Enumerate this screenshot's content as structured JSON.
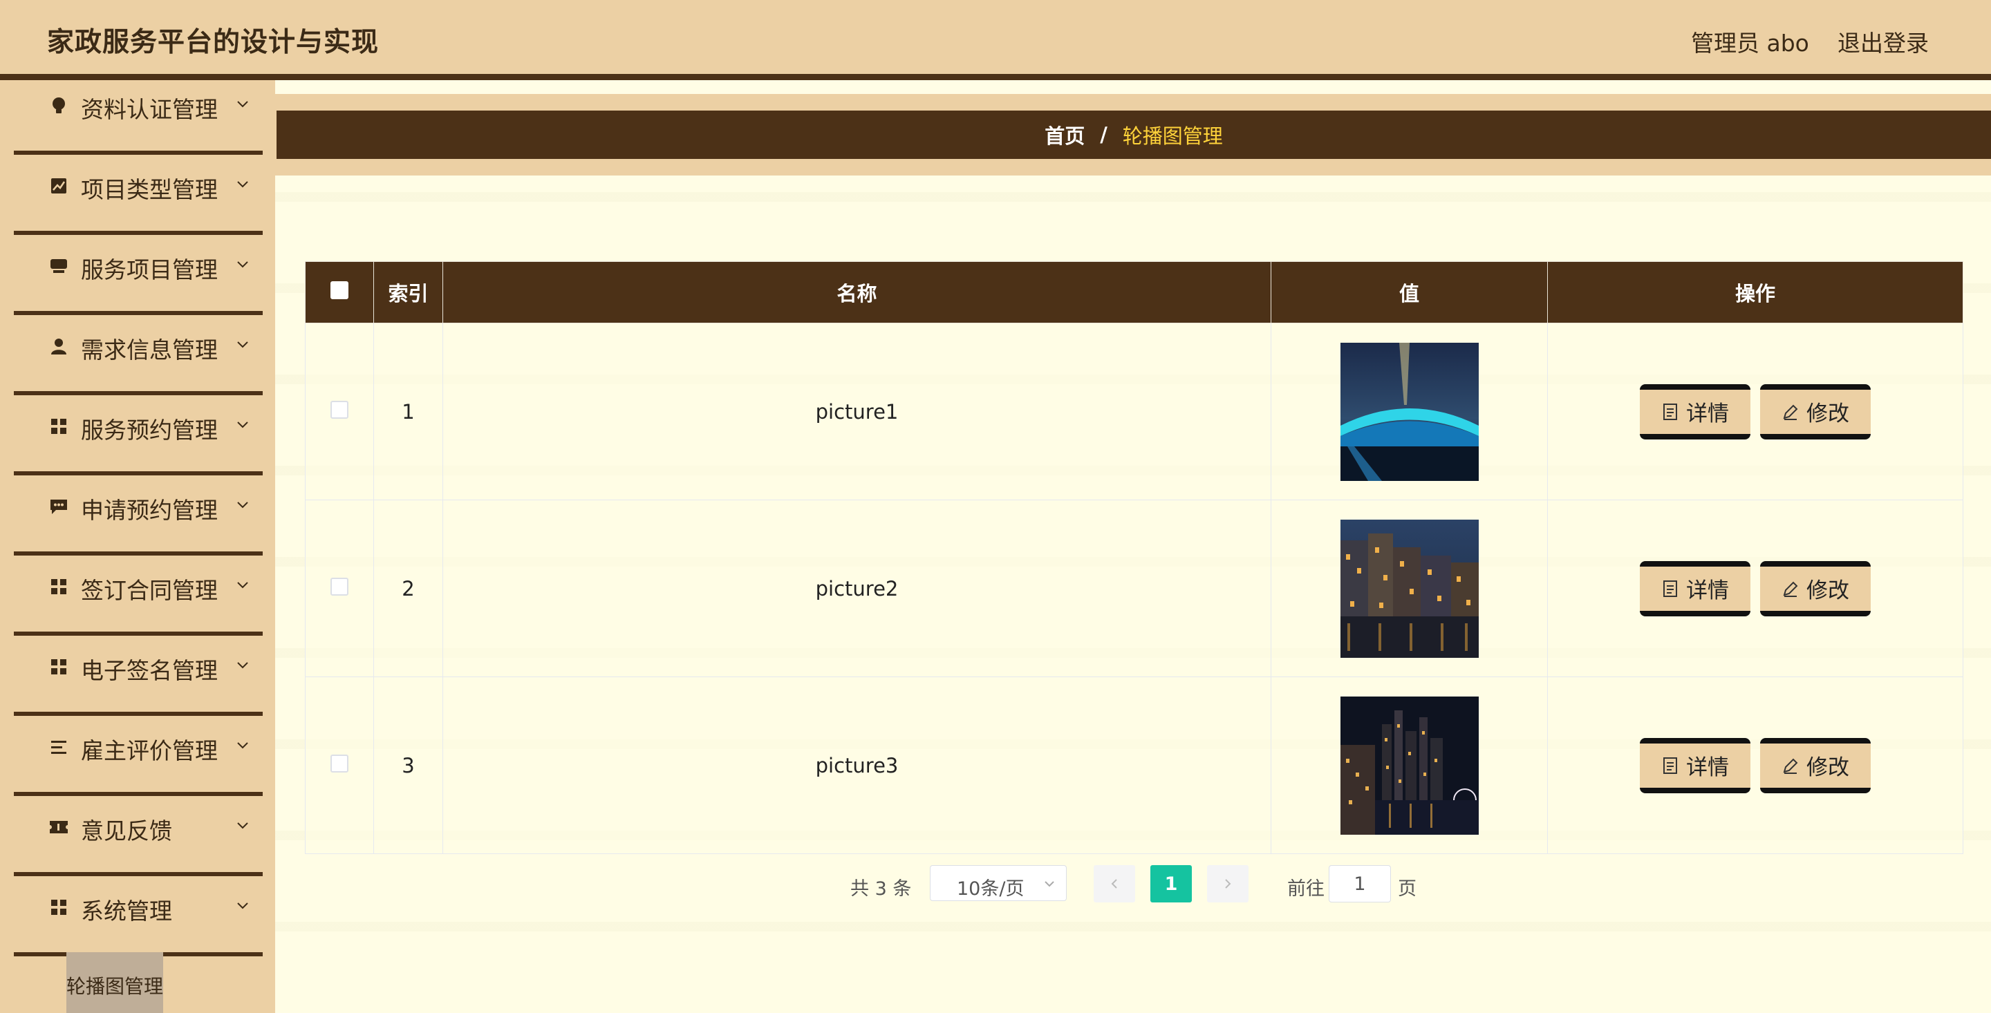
{
  "header": {
    "title": "家政服务平台的设计与实现",
    "user": "管理员 abo",
    "logout": "退出登录"
  },
  "sidebar": {
    "items": [
      {
        "label": "资料认证管理",
        "icon": "bulb-icon"
      },
      {
        "label": "项目类型管理",
        "icon": "chart-icon"
      },
      {
        "label": "服务项目管理",
        "icon": "cup-icon"
      },
      {
        "label": "需求信息管理",
        "icon": "user-icon"
      },
      {
        "label": "服务预约管理",
        "icon": "grid-icon"
      },
      {
        "label": "申请预约管理",
        "icon": "chat-icon"
      },
      {
        "label": "签订合同管理",
        "icon": "grid-icon"
      },
      {
        "label": "电子签名管理",
        "icon": "grid-icon"
      },
      {
        "label": "雇主评价管理",
        "icon": "list-icon"
      },
      {
        "label": "意见反馈",
        "icon": "ticket-icon"
      },
      {
        "label": "系统管理",
        "icon": "grid-icon"
      }
    ],
    "active_sub": "轮播图管理"
  },
  "breadcrumb": {
    "home": "首页",
    "separator": "/",
    "current": "轮播图管理"
  },
  "table": {
    "columns": [
      "索引",
      "名称",
      "值",
      "操作"
    ],
    "rows": [
      {
        "index": "1",
        "name": "picture1",
        "image": "night-bridge-photo"
      },
      {
        "index": "2",
        "name": "picture2",
        "image": "night-canal-houses-photo"
      },
      {
        "index": "3",
        "name": "picture3",
        "image": "night-city-skyline-photo"
      }
    ],
    "detail_label": "详情",
    "edit_label": "修改"
  },
  "pagination": {
    "total": "共 3 条",
    "page_size": "10条/页",
    "current_page": "1",
    "goto_label": "前往",
    "goto_value": "1",
    "page_word": "页"
  },
  "colors": {
    "brand_dark": "#4c3117",
    "brand_light": "#ecd0a4",
    "background": "#fffde5",
    "highlight": "#ffd33a",
    "page_active": "#15c3a0"
  }
}
